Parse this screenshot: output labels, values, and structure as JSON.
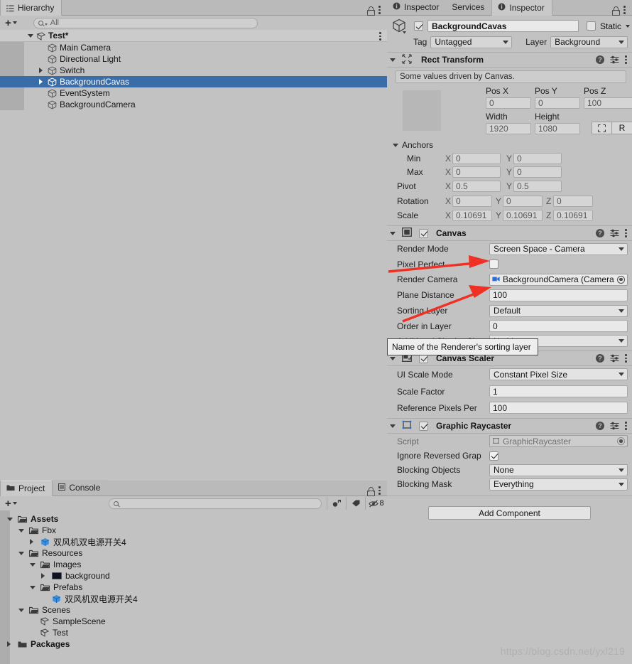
{
  "hierarchy": {
    "tab_label": "Hierarchy",
    "search_placeholder": "All",
    "search_value": "",
    "scene_name": "Test*",
    "items": [
      {
        "label": "Main Camera",
        "indent": 1,
        "expandable": false,
        "selected": false
      },
      {
        "label": "Directional Light",
        "indent": 1,
        "expandable": false,
        "selected": false
      },
      {
        "label": "Switch",
        "indent": 1,
        "expandable": true,
        "selected": false
      },
      {
        "label": "BackgroundCavas",
        "indent": 1,
        "expandable": true,
        "selected": true
      },
      {
        "label": "EventSystem",
        "indent": 1,
        "expandable": false,
        "selected": false
      },
      {
        "label": "BackgroundCamera",
        "indent": 1,
        "expandable": false,
        "selected": false
      }
    ]
  },
  "project": {
    "tab_label": "Project",
    "console_tab_label": "Console",
    "search_value": "",
    "hidden_count": "8",
    "rows": [
      {
        "label": "Assets",
        "indent": 0,
        "icon": "folder-open-icon",
        "expander": "open",
        "bold": true
      },
      {
        "label": "Fbx",
        "indent": 1,
        "icon": "folder-open-icon",
        "expander": "open",
        "bold": false
      },
      {
        "label": "双风机双电源开关4",
        "indent": 2,
        "icon": "prefab-icon",
        "expander": "closed",
        "bold": false
      },
      {
        "label": "Resources",
        "indent": 1,
        "icon": "folder-open-icon",
        "expander": "open",
        "bold": false
      },
      {
        "label": "Images",
        "indent": 2,
        "icon": "folder-open-icon",
        "expander": "open",
        "bold": false
      },
      {
        "label": "background",
        "indent": 3,
        "icon": "texture-icon",
        "expander": "closed",
        "bold": false
      },
      {
        "label": "Prefabs",
        "indent": 2,
        "icon": "folder-open-icon",
        "expander": "open",
        "bold": false
      },
      {
        "label": "双风机双电源开关4",
        "indent": 3,
        "icon": "prefab-icon",
        "expander": "none",
        "bold": false
      },
      {
        "label": "Scenes",
        "indent": 1,
        "icon": "folder-open-icon",
        "expander": "open",
        "bold": false
      },
      {
        "label": "SampleScene",
        "indent": 2,
        "icon": "scene-icon",
        "expander": "none",
        "bold": false
      },
      {
        "label": "Test",
        "indent": 2,
        "icon": "scene-icon",
        "expander": "none",
        "bold": false
      },
      {
        "label": "Packages",
        "indent": 0,
        "icon": "folder-closed-icon",
        "expander": "closed",
        "bold": true
      }
    ]
  },
  "inspector": {
    "tabs": [
      {
        "label": "Inspector",
        "active": false
      },
      {
        "label": "Services",
        "active": false
      },
      {
        "label": "Inspector",
        "active": true
      }
    ],
    "gameobject": {
      "enabled": true,
      "name": "BackgroundCavas",
      "static_label": "Static",
      "static_checked": false,
      "tag_label": "Tag",
      "tag_value": "Untagged",
      "layer_label": "Layer",
      "layer_value": "Background"
    },
    "rect_transform": {
      "title": "Rect Transform",
      "helpbox": "Some values driven by Canvas.",
      "pos_labels": [
        "Pos X",
        "Pos Y",
        "Pos Z"
      ],
      "pos_values": [
        "0",
        "0",
        "100"
      ],
      "size_labels": [
        "Width",
        "Height"
      ],
      "size_values": [
        "1920",
        "1080"
      ],
      "blueprint_label": "",
      "raw_label": "R",
      "anchors_label": "Anchors",
      "min_label": "Min",
      "min_values": [
        "0",
        "0"
      ],
      "max_label": "Max",
      "max_values": [
        "0",
        "0"
      ],
      "pivot_label": "Pivot",
      "pivot_values": [
        "0.5",
        "0.5"
      ],
      "rotation_label": "Rotation",
      "rotation_values": [
        "0",
        "0",
        "0"
      ],
      "scale_label": "Scale",
      "scale_values": [
        "0.10691",
        "0.10691",
        "0.10691"
      ]
    },
    "canvas": {
      "title": "Canvas",
      "enabled": true,
      "render_mode_label": "Render Mode",
      "render_mode_value": "Screen Space - Camera",
      "pixel_perfect_label": "Pixel Perfect",
      "pixel_perfect_checked": false,
      "render_camera_label": "Render Camera",
      "render_camera_value": "BackgroundCamera (Camera",
      "plane_distance_label": "Plane Distance",
      "plane_distance_value": "100",
      "sorting_layer_label": "Sorting Layer",
      "sorting_layer_value": "Default",
      "order_in_layer_label": "Order in Layer",
      "order_in_layer_value": "0",
      "additional_shader_label": "Additional Shader Ch",
      "additional_shader_value": "Nothing"
    },
    "canvas_scaler": {
      "title": "Canvas Scaler",
      "enabled": true,
      "ui_scale_mode_label": "UI Scale Mode",
      "ui_scale_mode_value": "Constant Pixel Size",
      "scale_factor_label": "Scale Factor",
      "scale_factor_value": "1",
      "reference_ppu_label": "Reference Pixels Per",
      "reference_ppu_value": "100"
    },
    "graphic_raycaster": {
      "title": "Graphic Raycaster",
      "enabled": true,
      "script_label": "Script",
      "script_value": "GraphicRaycaster",
      "ignore_reversed_label": "Ignore Reversed Grap",
      "ignore_reversed_checked": true,
      "blocking_objects_label": "Blocking Objects",
      "blocking_objects_value": "None",
      "blocking_mask_label": "Blocking Mask",
      "blocking_mask_value": "Everything"
    },
    "add_component_label": "Add Component"
  },
  "tooltip": {
    "text": "Name of the Renderer's sorting layer"
  },
  "watermark": {
    "text": "https://blog.csdn.net/yxl219"
  },
  "colors": {
    "selection_blue": "#3a6da8",
    "annotation_red": "#ee3124",
    "panel_bg": "#c2c2c2",
    "field_bg": "#d5d5d5"
  }
}
